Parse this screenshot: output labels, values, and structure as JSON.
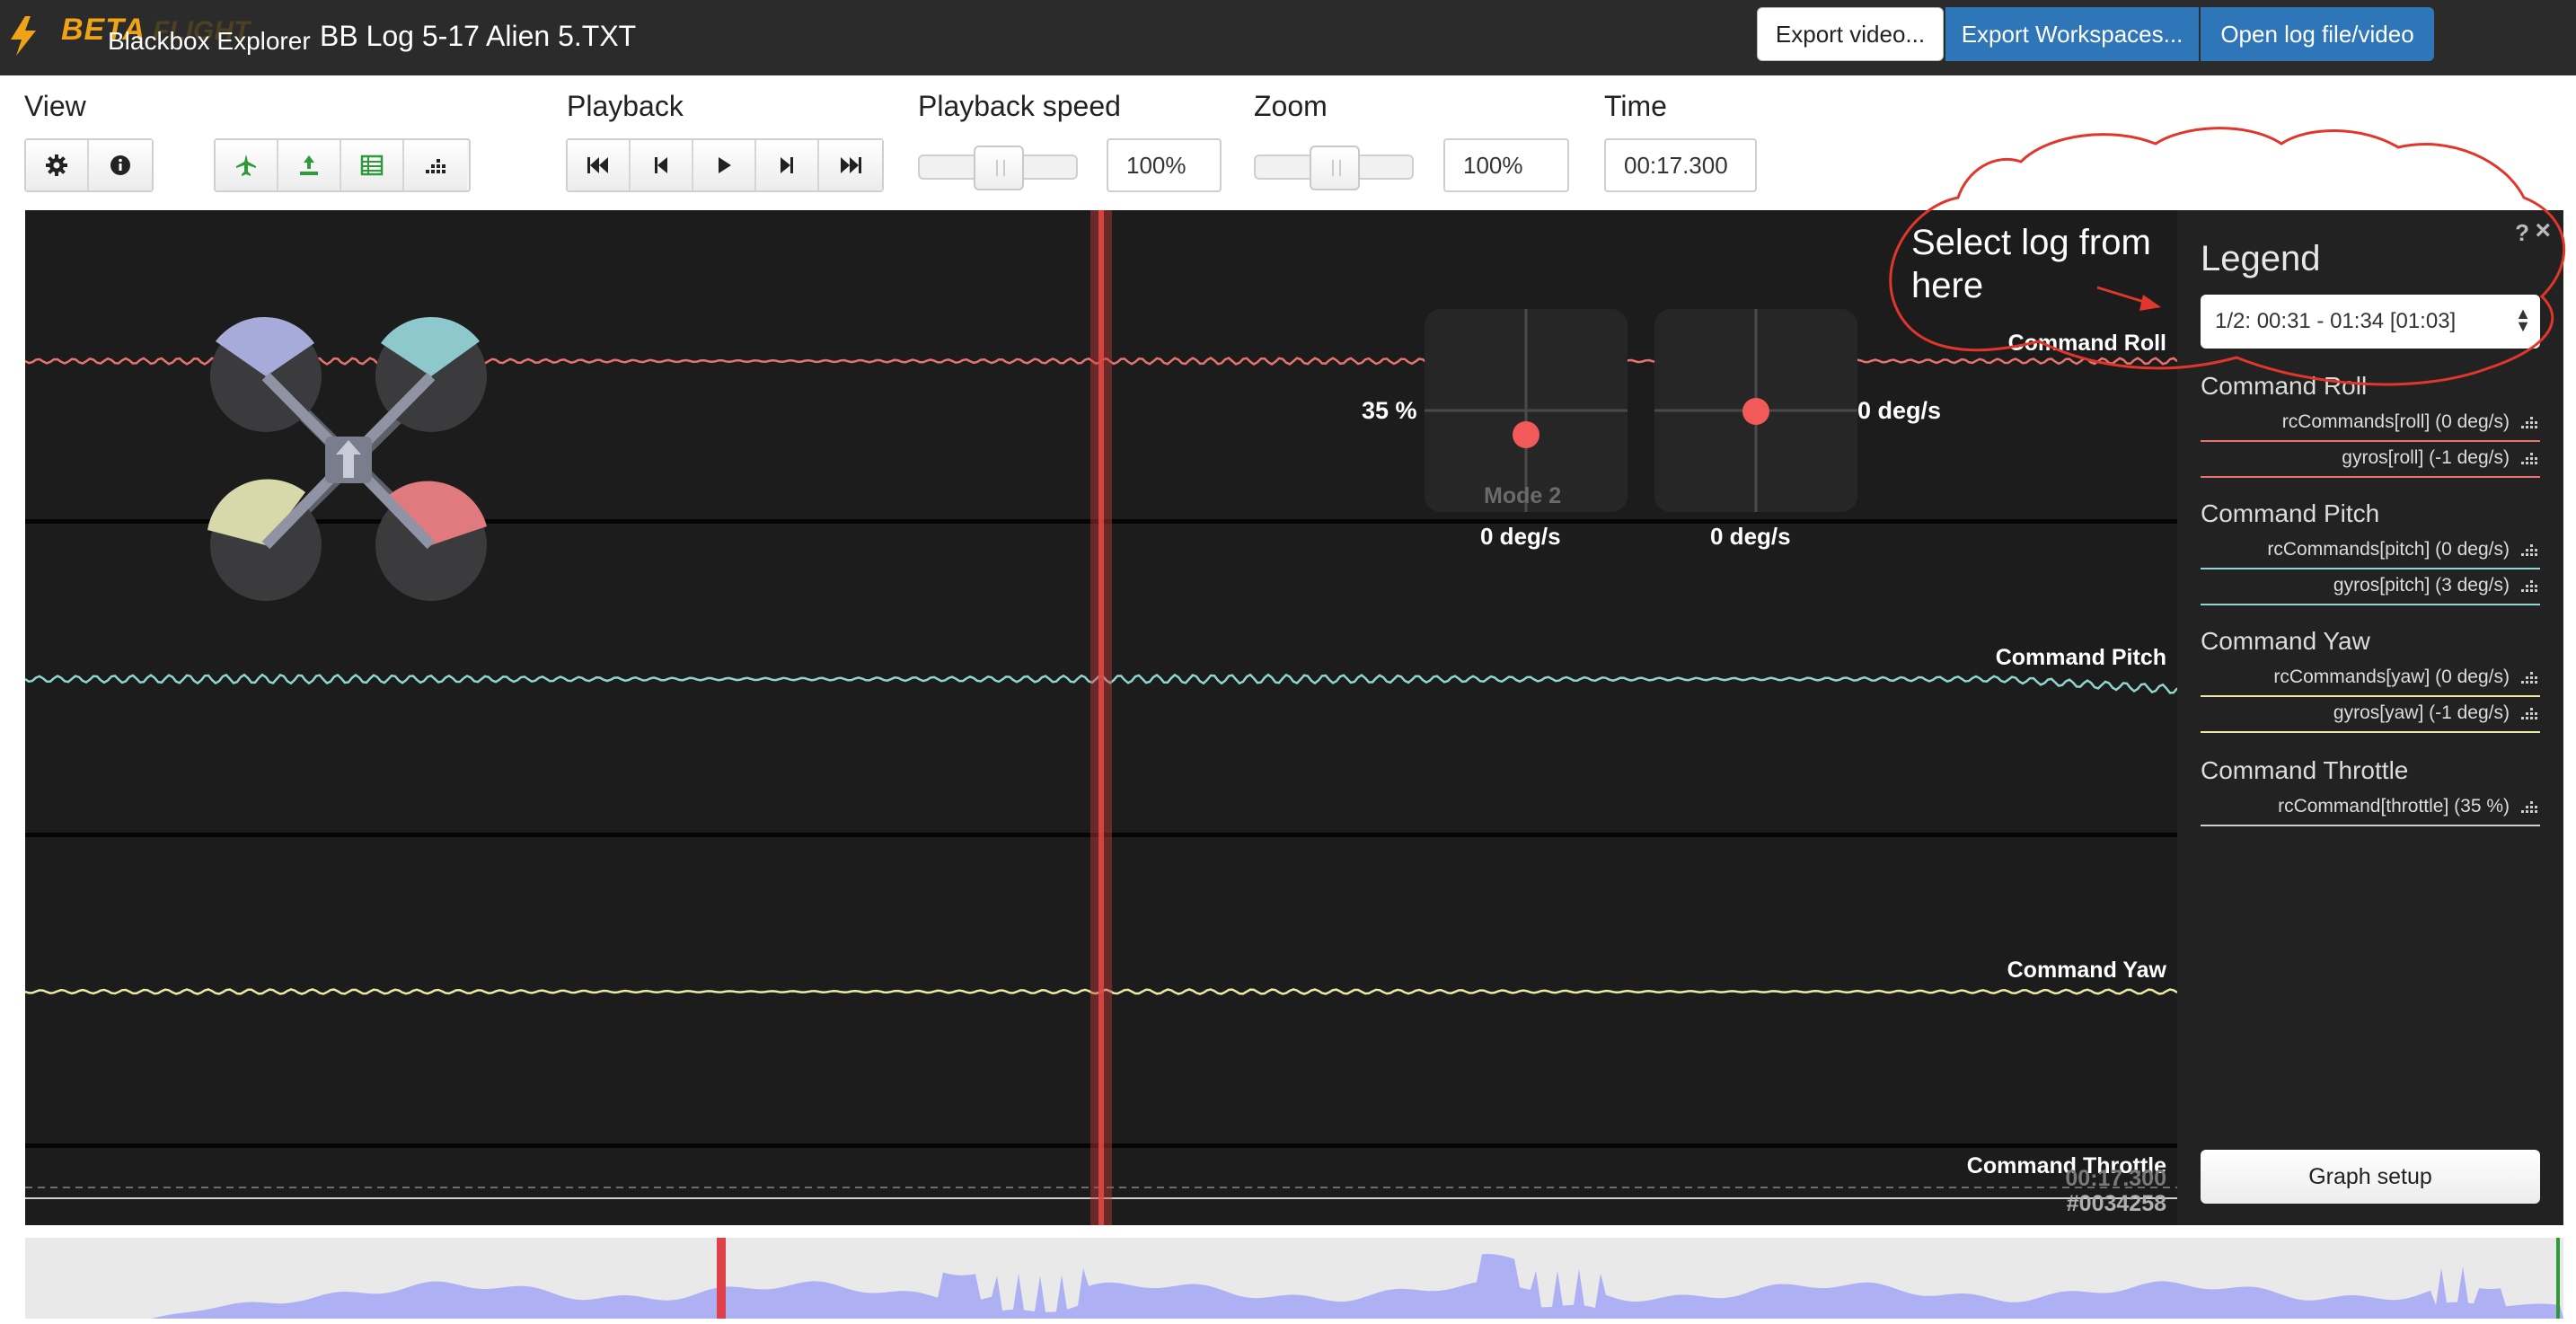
{
  "app": {
    "brand_beta": "BETA",
    "brand_flight": "FLIGHT",
    "brand_subtitle": "Blackbox Explorer",
    "log_title": "BB Log 5-17 Alien 5.TXT"
  },
  "header_buttons": {
    "export_video": "Export video...",
    "export_workspaces": "Export Workspaces...",
    "open_log": "Open log file/video"
  },
  "toolbar": {
    "view_label": "View",
    "playback_label": "Playback",
    "playback_speed_label": "Playback speed",
    "zoom_label": "Zoom",
    "time_label": "Time",
    "playback_speed_value": "100%",
    "zoom_value": "100%",
    "time_value": "00:17.300",
    "view_icons": [
      "gear-icon",
      "info-icon"
    ],
    "view_toggle_icons": [
      "aircraft-icon",
      "upload-icon",
      "table-icon",
      "histogram-icon"
    ],
    "playback_icons": [
      "skip-start-icon",
      "step-back-icon",
      "play-icon",
      "step-forward-icon",
      "skip-end-icon"
    ]
  },
  "graph": {
    "curves": [
      {
        "label": "Command Roll",
        "color": "#e8736e"
      },
      {
        "label": "Command Pitch",
        "color": "#8fd6cf"
      },
      {
        "label": "Command Yaw",
        "color": "#ece9a6"
      },
      {
        "label": "Command Throttle",
        "color": "#cfcfcf"
      }
    ],
    "motor_colors": [
      "#a6abd9",
      "#8dc8cc",
      "#d7d9ab",
      "#e07a7f"
    ],
    "stick_left_value_label": "35 %",
    "stick_left_bottom": "0 deg/s",
    "stick_left_mode": "Mode 2",
    "stick_right_value_label": "0 deg/s",
    "stick_right_bottom": "0 deg/s",
    "time_overlay": "00:17.300",
    "frame_overlay": "#0034258"
  },
  "legend": {
    "title": "Legend",
    "log_select_value": "1/2: 00:31 - 01:34 [01:03]",
    "groups": [
      {
        "title": "Command Roll",
        "items": [
          {
            "label": "rcCommands[roll] (0 deg/s)",
            "color": "#e8736e"
          },
          {
            "label": "gyros[roll] (-1 deg/s)",
            "color": "#e8736e"
          }
        ]
      },
      {
        "title": "Command Pitch",
        "items": [
          {
            "label": "rcCommands[pitch] (0 deg/s)",
            "color": "#8fd6cf"
          },
          {
            "label": "gyros[pitch] (3 deg/s)",
            "color": "#8fd6cf"
          }
        ]
      },
      {
        "title": "Command Yaw",
        "items": [
          {
            "label": "rcCommands[yaw] (0 deg/s)",
            "color": "#ece9a6"
          },
          {
            "label": "gyros[yaw] (-1 deg/s)",
            "color": "#ece9a6"
          }
        ]
      },
      {
        "title": "Command Throttle",
        "items": [
          {
            "label": "rcCommand[throttle] (35 %)",
            "color": "#cfcfcf"
          }
        ]
      }
    ],
    "graph_setup_label": "Graph setup"
  },
  "annotation": {
    "text": "Select log from here"
  },
  "timeline": {
    "fill_color": "#aeb0f4",
    "cursor_color": "#e0404a"
  }
}
